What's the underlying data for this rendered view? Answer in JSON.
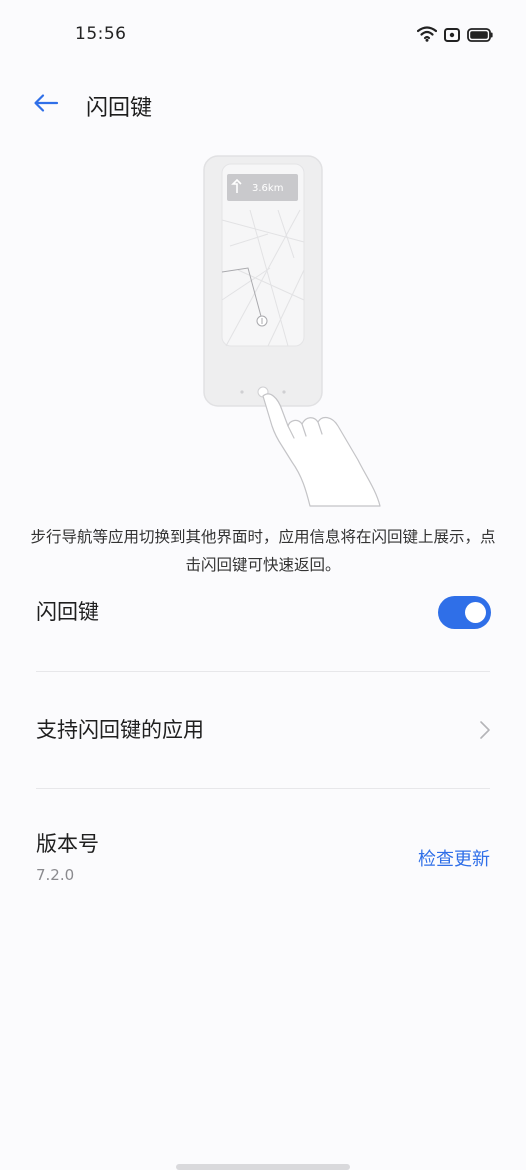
{
  "status_bar": {
    "time": "15:56",
    "icons": [
      "wifi-icon",
      "screen-record-icon",
      "battery-icon"
    ]
  },
  "header": {
    "back_icon": "arrow-left-icon",
    "title": "闪回键"
  },
  "illustration": {
    "nav_banner_text": "3.6km",
    "icons": [
      "phone-illustration",
      "turn-left-icon",
      "hand-pointer-illustration"
    ]
  },
  "description": "步行导航等应用切换到其他界面时，应用信息将在闪回键上展示，点击闪回键可快速返回。",
  "settings": {
    "flashback_toggle": {
      "label": "闪回键",
      "enabled": true
    },
    "supported_apps": {
      "label": "支持闪回键的应用",
      "icon": "chevron-right-icon"
    },
    "version": {
      "label": "版本号",
      "value": "7.2.0",
      "action_label": "检查更新"
    }
  },
  "colors": {
    "accent": "#2f6fe8",
    "background": "#fbfbfd",
    "divider": "#e7e7ea",
    "secondary_text": "#8a8a8e"
  }
}
